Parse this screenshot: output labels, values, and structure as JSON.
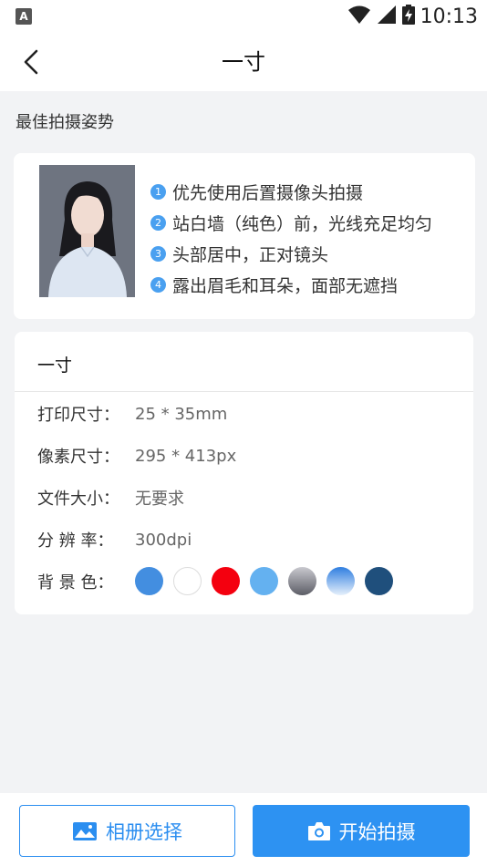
{
  "status_bar": {
    "time": "10:13",
    "app_icon_letter": "A",
    "icons": [
      "wifi-icon",
      "cell-signal-icon",
      "battery-charging-icon"
    ]
  },
  "nav": {
    "title": "一寸",
    "back_icon": "chevron-left-icon"
  },
  "section_label": "最佳拍摄姿势",
  "tips": [
    {
      "num": "1",
      "text": "优先使用后置摄像头拍摄"
    },
    {
      "num": "2",
      "text": "站白墙（纯色）前，光线充足均匀"
    },
    {
      "num": "3",
      "text": "头部居中，正对镜头"
    },
    {
      "num": "4",
      "text": "露出眉毛和耳朵，面部无遮挡"
    }
  ],
  "spec": {
    "title": "一寸",
    "rows": [
      {
        "key": "打印尺寸：",
        "value": "25 * 35mm"
      },
      {
        "key": "像素尺寸：",
        "value": "295 * 413px"
      },
      {
        "key": "文件大小：",
        "value": "无要求"
      },
      {
        "key": "分 辨 率：",
        "value": "300dpi"
      }
    ],
    "bg_label": "背 景 色：",
    "bg_colors": [
      "#438ee0",
      "#ffffff",
      "#f4000f",
      "#64b1f0",
      "gradient-gray",
      "gradient-blue",
      "#1f4f7c"
    ]
  },
  "buttons": {
    "album": "相册选择",
    "shoot": "开始拍摄"
  },
  "colors": {
    "accent": "#2d92f2",
    "tip_badge": "#4aa0f0"
  }
}
